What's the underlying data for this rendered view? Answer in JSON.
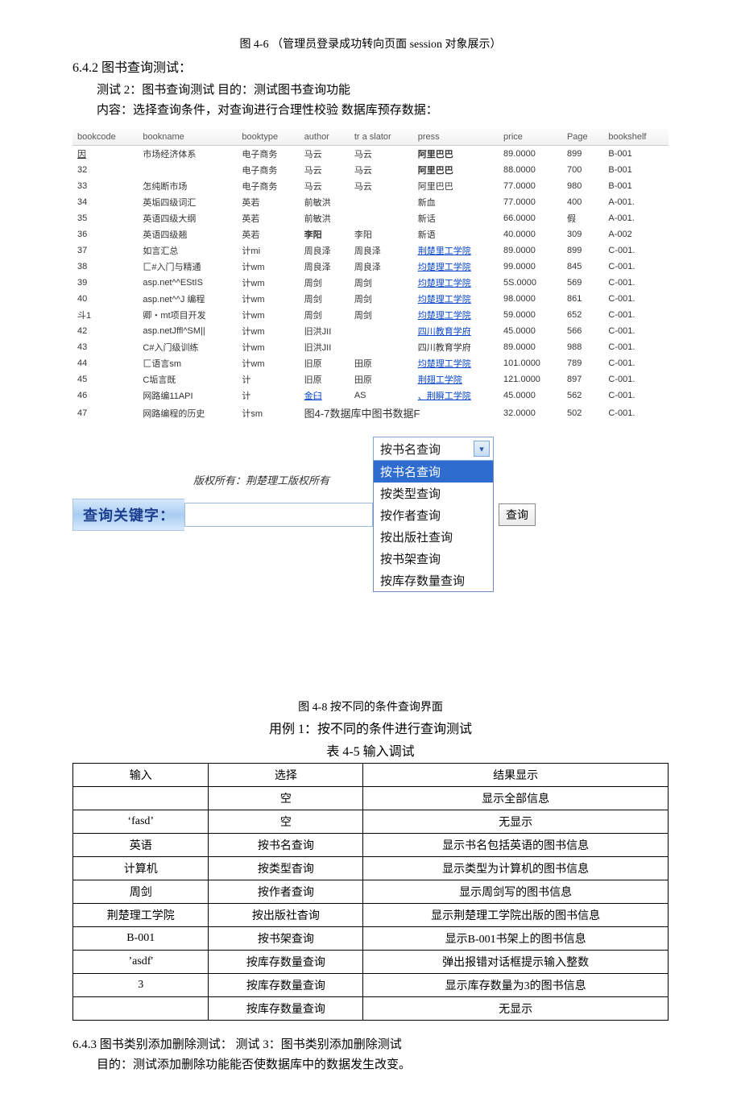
{
  "captions": {
    "fig46": "图 4-6 （管理员登录成功转向页面 session 对象展示）",
    "fig47_inline_a": "图4-7数据库中图书数据F",
    "fig48": "图 4-8 按不同的条件查询界面",
    "case1": "用例 1：按不同的条件进行查询测试",
    "table45": "表 4-5 输入调试"
  },
  "sections": {
    "s642_title": "6.4.2 图书查询测试：",
    "s642_l1": "测试 2：图书查询测试 目的：测试图书查询功能",
    "s642_l2": "内容：选择查询条件，对查询进行合理性校验 数据库预存数据：",
    "s643_title": "6.4.3 图书类别添加删除测试：   测试 3：图书类别添加删除测试",
    "s643_l1": "目的：测试添加删除功能能否使数据库中的数据发生改变。"
  },
  "db_headers": [
    "bookcode",
    "bookname",
    "booktype",
    "author",
    "tr a slator",
    "press",
    "price",
    "Page",
    "bookshelf"
  ],
  "db_rows": [
    {
      "code": "因",
      "code_link": true,
      "name": "市场经济体系",
      "type": "电子商务",
      "author": "马云",
      "translator": "马云",
      "press": "阿里巴巴",
      "press_bold": true,
      "price": "89.0000",
      "page": "899",
      "shelf": "B-001"
    },
    {
      "code": "32",
      "name": "",
      "type": "电子商务",
      "author": "马云",
      "translator": "马云",
      "press": "阿里巴巴",
      "press_bold": true,
      "price": "88.0000",
      "page": "700",
      "shelf": "B-001"
    },
    {
      "code": "33",
      "name": "怎纯断市场",
      "type": "电子商务",
      "author": "马云",
      "translator": "马云",
      "press": "阿里巴巴",
      "price": "77.0000",
      "page": "980",
      "shelf": "B-001"
    },
    {
      "code": "34",
      "name": "英垢四级词汇",
      "type": "英若",
      "author": "前敏洪",
      "translator": "",
      "press": "新血",
      "price": "77.0000",
      "page": "400",
      "shelf": "A-001."
    },
    {
      "code": "35",
      "name": "英语四级大纲",
      "type": "英若",
      "author": "前敏洪",
      "translator": "",
      "press": "新话",
      "price": "66.0000",
      "page": "假",
      "shelf": "A-001."
    },
    {
      "code": "36",
      "name": "英语四级翘",
      "type": "英若",
      "author": "李阳",
      "author_bold": true,
      "translator": "李阳",
      "press": "新语",
      "price": "40.0000",
      "page": "309",
      "shelf": "A-002"
    },
    {
      "code": "37",
      "name": "如言汇总",
      "type": "计mi",
      "author": "周良泽",
      "translator": "周良泽",
      "press": "荆楚里工学院",
      "press_link": true,
      "price": "89.0000",
      "page": "899",
      "shelf": "C-001."
    },
    {
      "code": "38",
      "name": "匚#入门与精通",
      "type": "计wm",
      "author": "周良泽",
      "translator": "周良泽",
      "press": "均楚理工学院",
      "press_link": true,
      "price": "99.0000",
      "page": "845",
      "shelf": "C-001."
    },
    {
      "code": "39",
      "name": "asp.net^^EStIS",
      "type": "计wm",
      "author": "周剑",
      "translator": "周剑",
      "press": "均楚理工学院",
      "press_link": true,
      "price": "5S.0000",
      "page": "569",
      "shelf": "C-001."
    },
    {
      "code": "40",
      "name": "asp.net^^J 编程",
      "type": "计wm",
      "author": "周剑",
      "translator": "周剑",
      "press": "均楚理工学院",
      "press_link": true,
      "price": "98.0000",
      "page": "861",
      "shelf": "C-001."
    },
    {
      "code": "斗1",
      "name": "卿・mt项目开发",
      "type": "计wm",
      "author": "周剑",
      "translator": "周剑",
      "press": "均楚理工学院",
      "press_link": true,
      "price": "59.0000",
      "page": "652",
      "shelf": "C-001."
    },
    {
      "code": "42",
      "name": "asp.netJffl^SM||",
      "type": "计wm",
      "author": "旧洪JII",
      "translator": "",
      "press": "四川教育学府",
      "press_link": true,
      "price": "45.0000",
      "page": "566",
      "shelf": "C-001."
    },
    {
      "code": "43",
      "name": "C#入门级训练",
      "type": "计wm",
      "author": "旧洪JII",
      "translator": "",
      "press": "四川教育学府",
      "price": "89.0000",
      "page": "988",
      "shelf": "C-001."
    },
    {
      "code": "44",
      "name": "匚语言sm",
      "type": "计wm",
      "author": "旧原",
      "translator": "田原",
      "press": "均楚理工学院",
      "press_link": true,
      "price": "101.0000",
      "page": "789",
      "shelf": "C-001."
    },
    {
      "code": "45",
      "name": "C垢言既",
      "type": "计",
      "author": "旧原",
      "translator": "田原",
      "press": "荆翅工学院",
      "press_link": true,
      "price": "121.0000",
      "page": "897",
      "shelf": "C-001."
    },
    {
      "code": "46",
      "name": "网路编11API",
      "type": "计",
      "author": "金臼",
      "author_link": true,
      "translator": "AS",
      "press": "、荆瞬工学院",
      "press_link": true,
      "price": "45.0000",
      "page": "562",
      "shelf": "C-001."
    },
    {
      "code": "47",
      "name": "网路编程的历史",
      "type": "计sm",
      "author": "",
      "translator": "",
      "press": "",
      "price": "32.0000",
      "page": "502",
      "shelf": "C-001."
    }
  ],
  "query_ui": {
    "label": "查询关键字：",
    "input_value": "",
    "select_value": "按书名查询",
    "button": "查询",
    "options": [
      "按书名查询",
      "按类型查询",
      "按作者查询",
      "按出版社查询",
      "按书架查询",
      "按库存数量查询"
    ],
    "copyright": "版权所有：荆楚理工版权所有"
  },
  "result_table": {
    "headers": [
      "输入",
      "选择",
      "结果显示"
    ],
    "rows": [
      [
        "",
        "空",
        "显示全部信息"
      ],
      [
        "‘fasd’",
        "空",
        "无显示"
      ],
      [
        "英语",
        "按书名查询",
        "显示书名包括英语的图书信息"
      ],
      [
        "计算机",
        "按类型杳询",
        "显示类型为计算机的图书信息"
      ],
      [
        "周剑",
        "按作者查询",
        "显示周剑写的图书信息"
      ],
      [
        "荆楚理工学院",
        "按出版社杳询",
        "显示荆楚理工学院出版的图书信息"
      ],
      [
        "B-001",
        "按书架查询",
        "显示B-001书架上的图书信息"
      ],
      [
        "’asdf'",
        "按库存数量查询",
        "弹出报错对话框提示输入整数"
      ],
      [
        "3",
        "按库存数量查询",
        "显示库存数量为3的图书信息"
      ],
      [
        "",
        "按库存数量查询",
        "无显示"
      ]
    ]
  }
}
